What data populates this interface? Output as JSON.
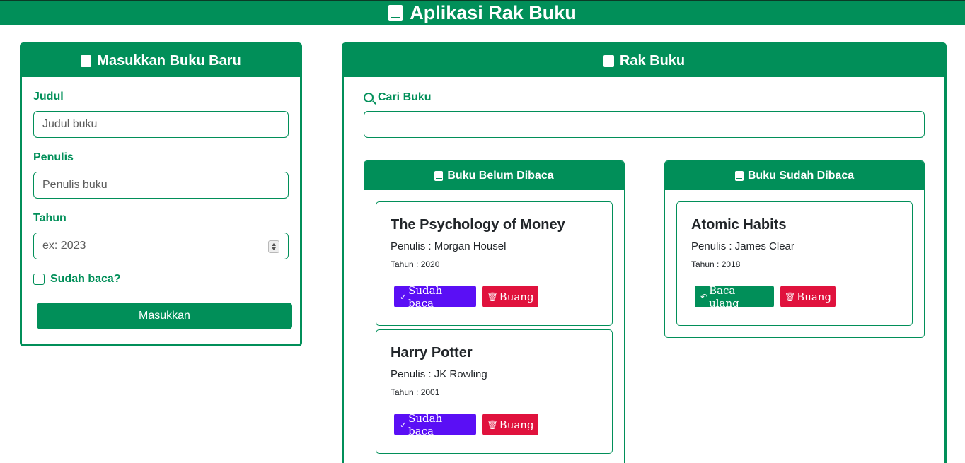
{
  "header": {
    "title": "Aplikasi Rak Buku",
    "icon": "book-icon"
  },
  "form": {
    "title": "Masukkan Buku Baru",
    "fields": {
      "judul_label": "Judul",
      "judul_placeholder": "Judul buku",
      "penulis_label": "Penulis",
      "penulis_placeholder": "Penulis buku",
      "tahun_label": "Tahun",
      "tahun_placeholder": "ex: 2023"
    },
    "checkbox_label": "Sudah baca?",
    "submit_label": "Masukkan"
  },
  "shelf": {
    "title": "Rak Buku",
    "search_label": "Cari Buku",
    "search_value": "",
    "belum": {
      "title": "Buku Belum Dibaca",
      "books": [
        {
          "title": "The Psychology of Money",
          "author": "Penulis : Morgan Housel",
          "year": "Tahun : 2020",
          "action_label": "Sudah baca",
          "delete_label": "Buang"
        },
        {
          "title": "Harry Potter",
          "author": "Penulis : JK Rowling",
          "year": "Tahun : 2001",
          "action_label": "Sudah baca",
          "delete_label": "Buang"
        }
      ]
    },
    "sudah": {
      "title": "Buku Sudah Dibaca",
      "books": [
        {
          "title": "Atomic Habits",
          "author": "Penulis : James Clear",
          "year": "Tahun : 2018",
          "action_label": "Baca ulang",
          "delete_label": "Buang"
        }
      ]
    }
  },
  "colors": {
    "primary": "#018f59",
    "purple": "#5a0ff5",
    "red": "#e0123d"
  }
}
